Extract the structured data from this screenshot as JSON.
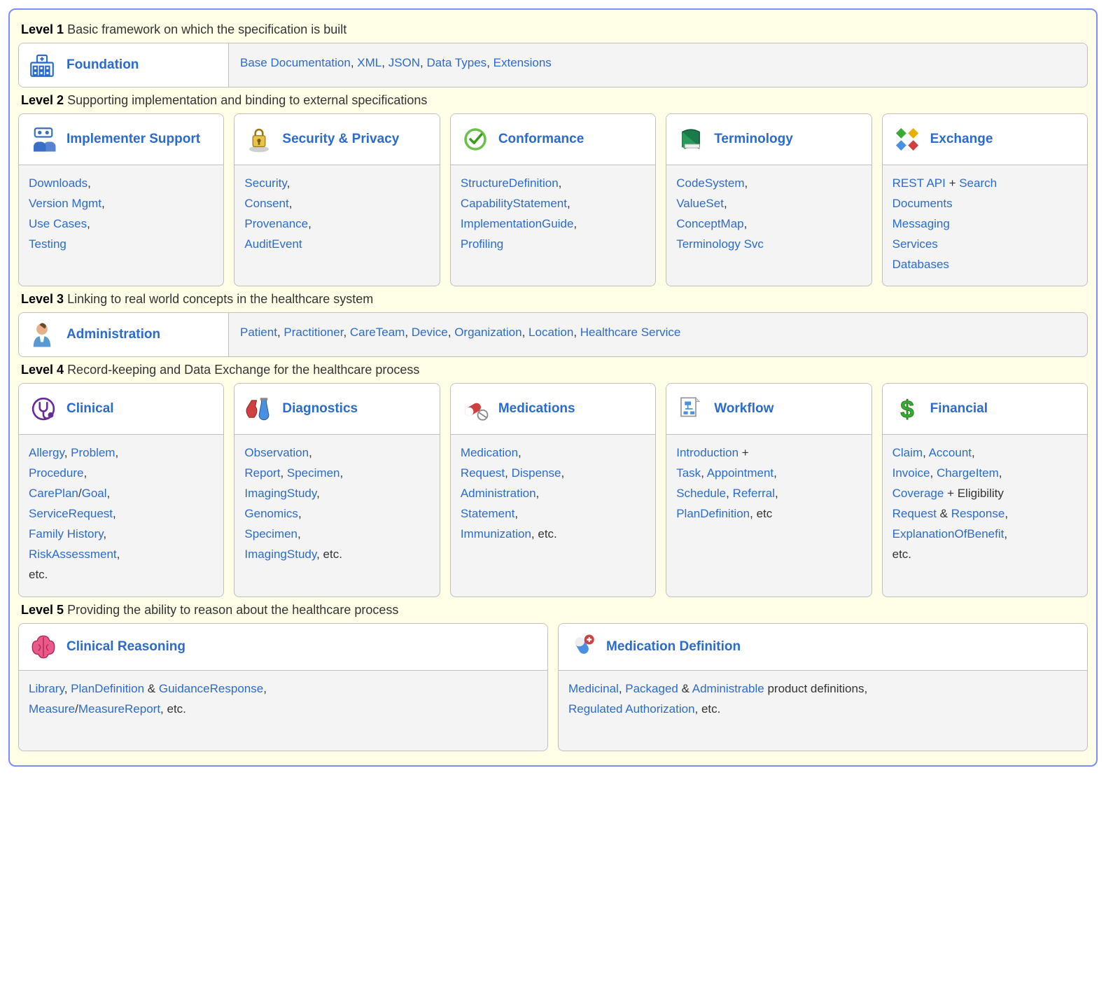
{
  "levels": {
    "l1": {
      "label": "Level 1",
      "desc": "Basic framework on which the specification is built"
    },
    "l2": {
      "label": "Level 2",
      "desc": "Supporting implementation and binding to external specifications"
    },
    "l3": {
      "label": "Level 3",
      "desc": "Linking to real world concepts in the healthcare system"
    },
    "l4": {
      "label": "Level 4",
      "desc": "Record-keeping and Data Exchange for the healthcare process"
    },
    "l5": {
      "label": "Level 5",
      "desc": "Providing the ability to reason about the healthcare process"
    }
  },
  "foundation": {
    "title": "Foundation",
    "links": {
      "base": "Base Documentation",
      "xml": "XML",
      "json": "JSON",
      "datatypes": "Data Types",
      "ext": "Extensions"
    }
  },
  "impl": {
    "title": "Implementer Support",
    "links": {
      "downloads": "Downloads",
      "version": "Version Mgmt",
      "usecases": "Use Cases",
      "testing": "Testing"
    }
  },
  "sec": {
    "title": "Security & Privacy",
    "links": {
      "security": "Security",
      "consent": "Consent",
      "prov": "Provenance",
      "audit": "AuditEvent"
    }
  },
  "conf": {
    "title": "Conformance",
    "links": {
      "sd": "StructureDefinition",
      "cap": "CapabilityStatement",
      "ig": "ImplementationGuide",
      "prof": "Profiling"
    }
  },
  "term": {
    "title": "Terminology",
    "links": {
      "cs": "CodeSystem",
      "vs": "ValueSet",
      "cm": "ConceptMap",
      "svc": "Terminology Svc"
    }
  },
  "exch": {
    "title": "Exchange",
    "links": {
      "rest": "REST API",
      "search": "Search",
      "docs": "Documents",
      "msg": "Messaging",
      "svc": "Services",
      "db": "Databases"
    },
    "plus": " + "
  },
  "admin": {
    "title": "Administration",
    "links": {
      "patient": "Patient",
      "pract": "Practitioner",
      "care": "CareTeam",
      "device": "Device",
      "org": "Organization",
      "loc": "Location",
      "hs": "Healthcare Service"
    }
  },
  "clinical": {
    "title": "Clinical",
    "links": {
      "allergy": "Allergy",
      "problem": "Problem",
      "proc": "Procedure",
      "cp": "CarePlan",
      "goal": "Goal",
      "sr": "ServiceRequest",
      "fh": "Family History",
      "ra": "RiskAssessment"
    },
    "etc": "etc."
  },
  "diag": {
    "title": "Diagnostics",
    "links": {
      "obs": "Observation",
      "rep": "Report",
      "spec": "Specimen",
      "img": "ImagingStudy",
      "gen": "Genomics",
      "spec2": "Specimen",
      "img2": "ImagingStudy"
    },
    "etc": ", etc."
  },
  "meds": {
    "title": "Medications",
    "links": {
      "med": "Medication",
      "req": "Request",
      "disp": "Dispense",
      "admin": "Administration",
      "stmt": "Statement",
      "imm": "Immunization"
    },
    "etc": ", etc."
  },
  "wf": {
    "title": "Workflow",
    "links": {
      "intro": "Introduction",
      "task": "Task",
      "appt": "Appointment",
      "sched": "Schedule",
      "ref": "Referral",
      "pd": "PlanDefinition"
    },
    "plus": " + ",
    "etc": ", etc"
  },
  "fin": {
    "title": "Financial",
    "links": {
      "claim": "Claim",
      "acct": "Account",
      "inv": "Invoice",
      "ci": "ChargeItem",
      "cov": "Coverage",
      "req": "Request",
      "resp": "Response",
      "eob": "ExplanationOfBenefit"
    },
    "plus_elig": " + Eligibility ",
    "amp": " & ",
    "etc": "etc."
  },
  "cr": {
    "title": "Clinical Reasoning",
    "links": {
      "lib": "Library",
      "pd": "PlanDefinition",
      "gr": "GuidanceResponse",
      "measure": "Measure",
      "mr": "MeasureReport"
    },
    "amp": " & ",
    "etc": ", etc."
  },
  "md": {
    "title": "Medication Definition",
    "links": {
      "med": "Medicinal",
      "pack": "Packaged",
      "admin": "Administrable",
      "ra": "Regulated Authorization"
    },
    "amp": " & ",
    "tail": " product definitions, ",
    "etc": ", etc."
  },
  "sep": ", ",
  "slash": "/"
}
